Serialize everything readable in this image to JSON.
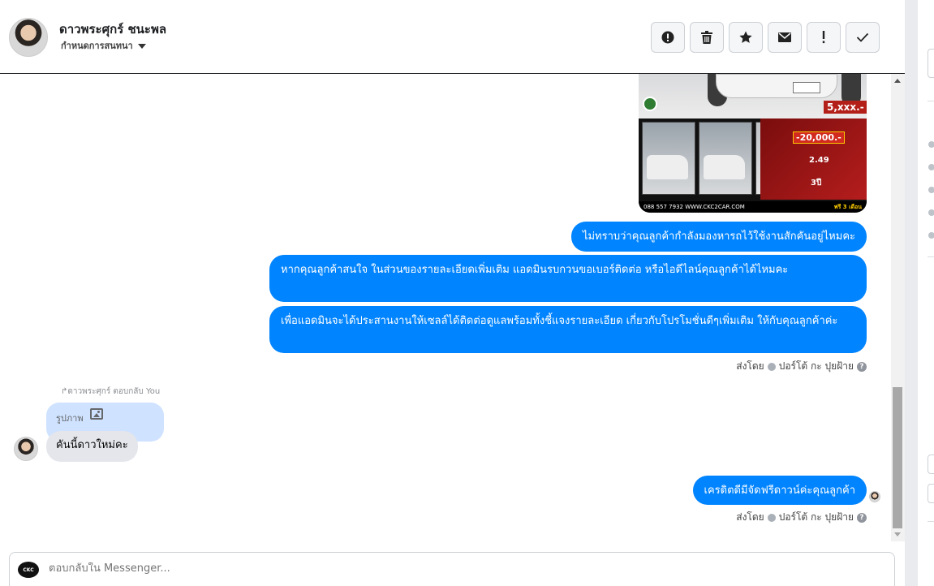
{
  "header": {
    "contact_name": "ดาวพระศุกร์ ชนะพล",
    "assign_label": "กำหนดการสนทนา"
  },
  "toolbar": [
    {
      "name": "spam-button",
      "icon": "alert-circle-icon"
    },
    {
      "name": "delete-button",
      "icon": "trash-icon"
    },
    {
      "name": "star-button",
      "icon": "star-icon"
    },
    {
      "name": "mark-unread-button",
      "icon": "envelope-icon"
    },
    {
      "name": "follow-up-button",
      "icon": "exclamation-icon"
    },
    {
      "name": "mark-done-button",
      "icon": "check-icon"
    }
  ],
  "image_ad": {
    "price": "5,xxx.-",
    "discount": "-20,000.-",
    "rate": "2.49",
    "years": "3ปี",
    "phone_url": "088 557 7932 WWW.CKC2CAR.COM",
    "promo_text": "ฟรี 3 เดือน"
  },
  "messages_out": [
    "ไม่ทราบว่าคุณลูกค้ากำลังมองหารถไว้ใช้งานสักคันอยู่ไหมคะ",
    "หากคุณลูกค้าสนใจ ในส่วนของรายละเอียดเพิ่มเติม แอดมินรบกวนขอเบอร์ติดต่อ หรือไอดีไลน์คุณลูกค้าได้ไหมคะ",
    "เพื่อแอดมินจะได้ประสานงานให้เซลล์ได้ติดต่อดูแลพร้อมทั้งชี้แจงรายละเอียด เกี่ยวกับโปรโมชั่นดีๆเพิ่มเติม ให้กับคุณลูกค้าค่ะ"
  ],
  "sent_by": {
    "prefix": "ส่งโดย",
    "agent": "ปอร์โต้ กะ ปุยฝ้าย"
  },
  "reply_note": "↱ดาวพระศุกร์ ตอบกลับ You",
  "quoted": {
    "label": "รูปภาพ"
  },
  "message_in": "คันนี้ดาวใหม่คะ",
  "last_message_out": "เครดิตดีมีจัดฟรีดาวน์ค่ะคุณลูกค้า",
  "composer": {
    "placeholder": "ตอบกลับใน Messenger..."
  },
  "colors": {
    "outgoing_bubble": "#0084ff",
    "incoming_bubble": "#e4e6eb",
    "quote_bubble": "#cfe2ff"
  }
}
